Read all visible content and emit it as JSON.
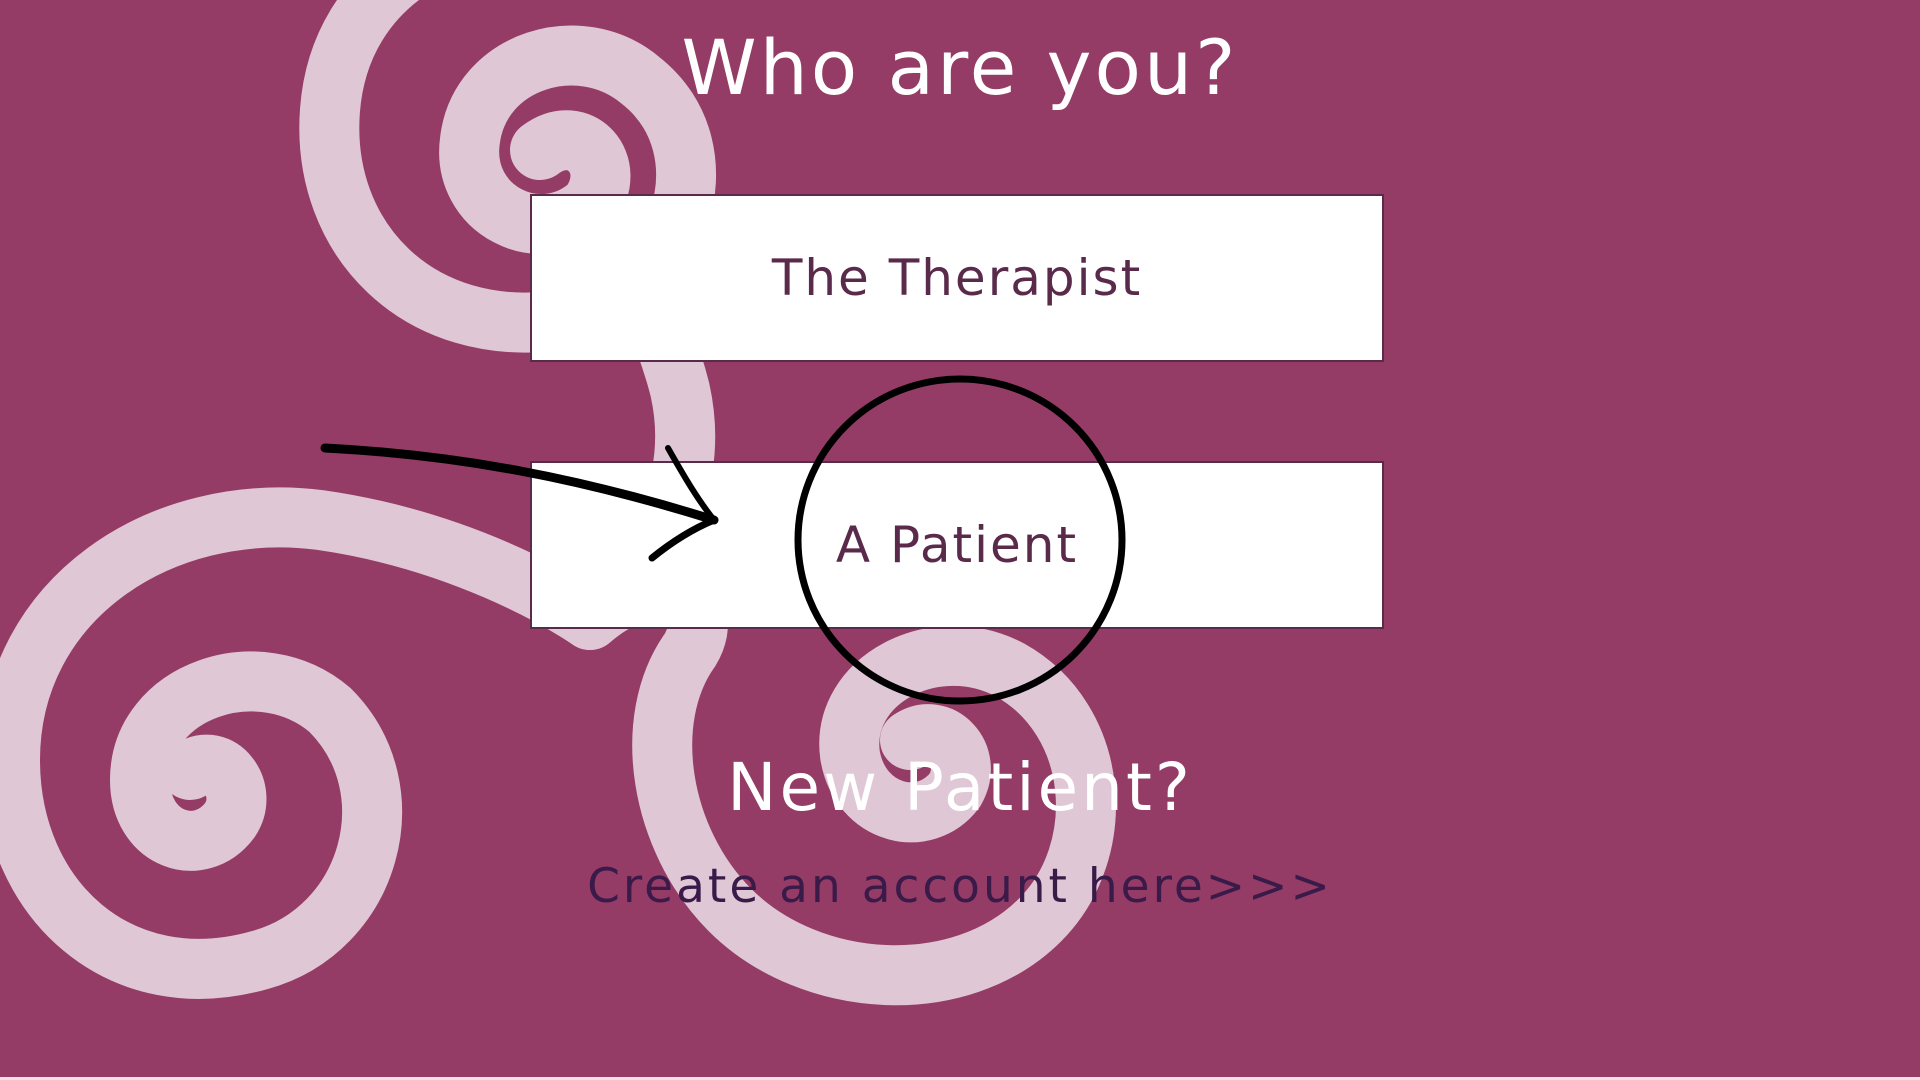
{
  "heading": "Who are you?",
  "roles": {
    "therapist_label": "The Therapist",
    "patient_label": "A Patient"
  },
  "signup": {
    "prompt": "New Patient?",
    "link_label": "Create an account here>>>"
  },
  "colors": {
    "background": "#943c66",
    "spiral": "#e0c7d5",
    "button_background": "#ffffff",
    "button_text": "#5a2a4a",
    "link_text": "#3a1a48",
    "annotation": "#000000"
  },
  "icons": {
    "annotation_arrow": "arrow-right-icon",
    "annotation_circle": "highlight-circle-icon"
  }
}
